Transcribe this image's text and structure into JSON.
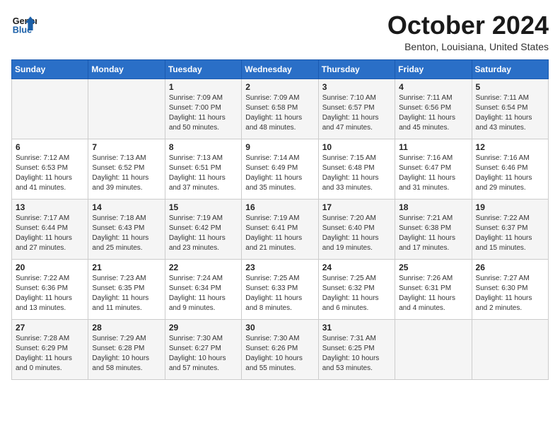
{
  "header": {
    "logo_line1": "General",
    "logo_line2": "Blue",
    "month_title": "October 2024",
    "location": "Benton, Louisiana, United States"
  },
  "days_of_week": [
    "Sunday",
    "Monday",
    "Tuesday",
    "Wednesday",
    "Thursday",
    "Friday",
    "Saturday"
  ],
  "weeks": [
    [
      {
        "day": "",
        "info": ""
      },
      {
        "day": "",
        "info": ""
      },
      {
        "day": "1",
        "info": "Sunrise: 7:09 AM\nSunset: 7:00 PM\nDaylight: 11 hours and 50 minutes."
      },
      {
        "day": "2",
        "info": "Sunrise: 7:09 AM\nSunset: 6:58 PM\nDaylight: 11 hours and 48 minutes."
      },
      {
        "day": "3",
        "info": "Sunrise: 7:10 AM\nSunset: 6:57 PM\nDaylight: 11 hours and 47 minutes."
      },
      {
        "day": "4",
        "info": "Sunrise: 7:11 AM\nSunset: 6:56 PM\nDaylight: 11 hours and 45 minutes."
      },
      {
        "day": "5",
        "info": "Sunrise: 7:11 AM\nSunset: 6:54 PM\nDaylight: 11 hours and 43 minutes."
      }
    ],
    [
      {
        "day": "6",
        "info": "Sunrise: 7:12 AM\nSunset: 6:53 PM\nDaylight: 11 hours and 41 minutes."
      },
      {
        "day": "7",
        "info": "Sunrise: 7:13 AM\nSunset: 6:52 PM\nDaylight: 11 hours and 39 minutes."
      },
      {
        "day": "8",
        "info": "Sunrise: 7:13 AM\nSunset: 6:51 PM\nDaylight: 11 hours and 37 minutes."
      },
      {
        "day": "9",
        "info": "Sunrise: 7:14 AM\nSunset: 6:49 PM\nDaylight: 11 hours and 35 minutes."
      },
      {
        "day": "10",
        "info": "Sunrise: 7:15 AM\nSunset: 6:48 PM\nDaylight: 11 hours and 33 minutes."
      },
      {
        "day": "11",
        "info": "Sunrise: 7:16 AM\nSunset: 6:47 PM\nDaylight: 11 hours and 31 minutes."
      },
      {
        "day": "12",
        "info": "Sunrise: 7:16 AM\nSunset: 6:46 PM\nDaylight: 11 hours and 29 minutes."
      }
    ],
    [
      {
        "day": "13",
        "info": "Sunrise: 7:17 AM\nSunset: 6:44 PM\nDaylight: 11 hours and 27 minutes."
      },
      {
        "day": "14",
        "info": "Sunrise: 7:18 AM\nSunset: 6:43 PM\nDaylight: 11 hours and 25 minutes."
      },
      {
        "day": "15",
        "info": "Sunrise: 7:19 AM\nSunset: 6:42 PM\nDaylight: 11 hours and 23 minutes."
      },
      {
        "day": "16",
        "info": "Sunrise: 7:19 AM\nSunset: 6:41 PM\nDaylight: 11 hours and 21 minutes."
      },
      {
        "day": "17",
        "info": "Sunrise: 7:20 AM\nSunset: 6:40 PM\nDaylight: 11 hours and 19 minutes."
      },
      {
        "day": "18",
        "info": "Sunrise: 7:21 AM\nSunset: 6:38 PM\nDaylight: 11 hours and 17 minutes."
      },
      {
        "day": "19",
        "info": "Sunrise: 7:22 AM\nSunset: 6:37 PM\nDaylight: 11 hours and 15 minutes."
      }
    ],
    [
      {
        "day": "20",
        "info": "Sunrise: 7:22 AM\nSunset: 6:36 PM\nDaylight: 11 hours and 13 minutes."
      },
      {
        "day": "21",
        "info": "Sunrise: 7:23 AM\nSunset: 6:35 PM\nDaylight: 11 hours and 11 minutes."
      },
      {
        "day": "22",
        "info": "Sunrise: 7:24 AM\nSunset: 6:34 PM\nDaylight: 11 hours and 9 minutes."
      },
      {
        "day": "23",
        "info": "Sunrise: 7:25 AM\nSunset: 6:33 PM\nDaylight: 11 hours and 8 minutes."
      },
      {
        "day": "24",
        "info": "Sunrise: 7:25 AM\nSunset: 6:32 PM\nDaylight: 11 hours and 6 minutes."
      },
      {
        "day": "25",
        "info": "Sunrise: 7:26 AM\nSunset: 6:31 PM\nDaylight: 11 hours and 4 minutes."
      },
      {
        "day": "26",
        "info": "Sunrise: 7:27 AM\nSunset: 6:30 PM\nDaylight: 11 hours and 2 minutes."
      }
    ],
    [
      {
        "day": "27",
        "info": "Sunrise: 7:28 AM\nSunset: 6:29 PM\nDaylight: 11 hours and 0 minutes."
      },
      {
        "day": "28",
        "info": "Sunrise: 7:29 AM\nSunset: 6:28 PM\nDaylight: 10 hours and 58 minutes."
      },
      {
        "day": "29",
        "info": "Sunrise: 7:30 AM\nSunset: 6:27 PM\nDaylight: 10 hours and 57 minutes."
      },
      {
        "day": "30",
        "info": "Sunrise: 7:30 AM\nSunset: 6:26 PM\nDaylight: 10 hours and 55 minutes."
      },
      {
        "day": "31",
        "info": "Sunrise: 7:31 AM\nSunset: 6:25 PM\nDaylight: 10 hours and 53 minutes."
      },
      {
        "day": "",
        "info": ""
      },
      {
        "day": "",
        "info": ""
      }
    ]
  ]
}
